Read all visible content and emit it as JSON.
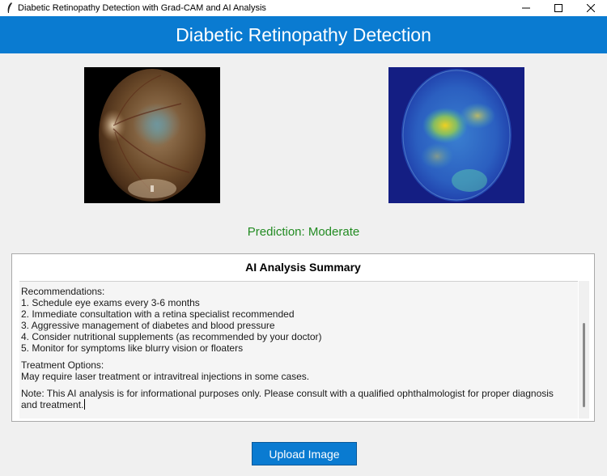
{
  "window": {
    "title": "Diabetic Retinopathy Detection with Grad-CAM and AI Analysis",
    "controls": [
      "minimize-icon",
      "maximize-icon",
      "close-icon"
    ]
  },
  "header": {
    "title": "Diabetic Retinopathy Detection",
    "background": "#0a7bd1"
  },
  "images": {
    "original": "fundus-image",
    "gradcam": "gradcam-heatmap-image"
  },
  "prediction": {
    "text": "Prediction: Moderate",
    "color": "#228b22"
  },
  "analysis": {
    "title": "AI Analysis Summary",
    "recommendations_heading": "Recommendations:",
    "recommendations": [
      "1. Schedule eye exams every 3-6 months",
      "2. Immediate consultation with a retina specialist recommended",
      "3. Aggressive management of diabetes and blood pressure",
      "4. Consider nutritional supplements (as recommended by your doctor)",
      "5. Monitor for symptoms like blurry vision or floaters"
    ],
    "treatment_heading": "Treatment Options:",
    "treatment_text": "May require laser treatment or intravitreal injections in some cases.",
    "note": "Note: This AI analysis is for informational purposes only. Please consult with a qualified ophthalmologist for proper diagnosis and treatment."
  },
  "upload_button": {
    "label": "Upload Image"
  }
}
